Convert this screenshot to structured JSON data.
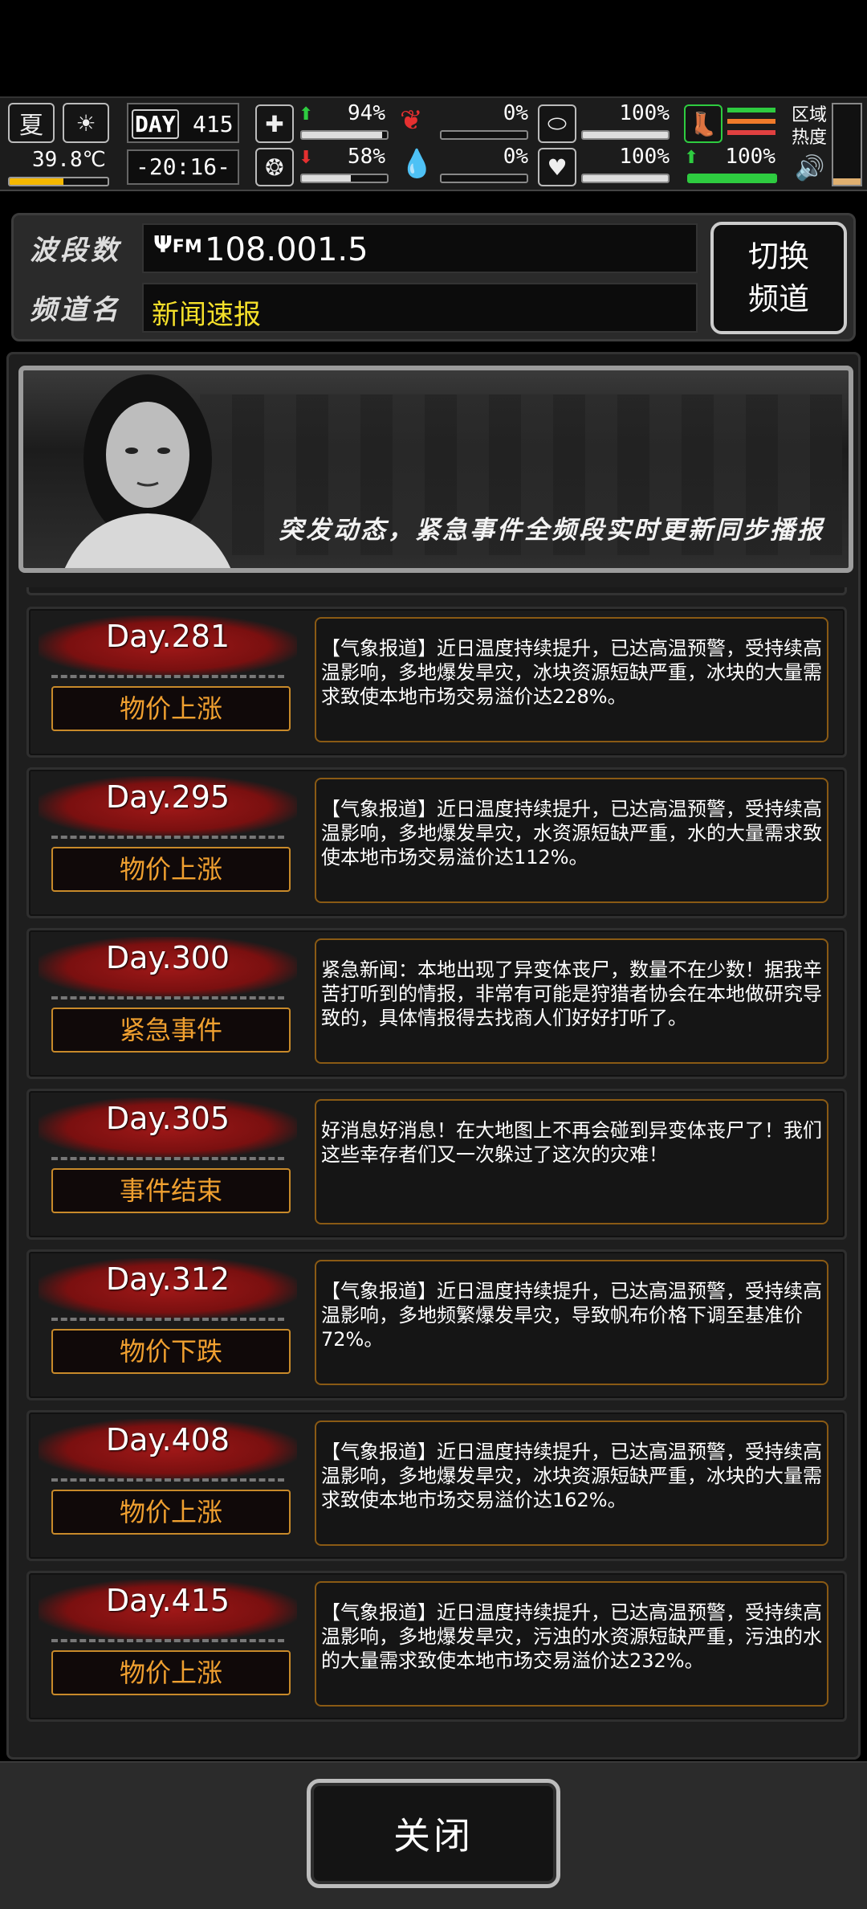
{
  "status": {
    "season": "夏",
    "temperature": "39.8℃",
    "temperature_level": 0.55,
    "day_badge": "DAY",
    "day_number": "415",
    "clock": "-20:16-",
    "stats": [
      {
        "icon": "medkit-icon",
        "arrow": "up",
        "value": "94%",
        "level": 0.94
      },
      {
        "icon": "brain-icon",
        "arrow": "down",
        "value": "58%",
        "level": 0.58
      },
      {
        "icon": "stomach-icon",
        "arrow": "",
        "value": "0%",
        "level": 0
      },
      {
        "icon": "blood-drop-icon",
        "arrow": "",
        "value": "0%",
        "level": 0
      },
      {
        "icon": "pill-icon",
        "arrow": "",
        "value": "100%",
        "level": 1
      },
      {
        "icon": "heart-icon",
        "arrow": "",
        "value": "100%",
        "level": 1
      },
      {
        "icon": "boot-icon",
        "arrow": "up",
        "value": "100%",
        "level": 1
      }
    ],
    "region_label_1": "区域",
    "region_label_2": "热度"
  },
  "radio": {
    "band_label": "波段数",
    "fm_label": "FM",
    "frequency": "108.001.5",
    "channel_label": "频道名",
    "channel_name": "新闻速报",
    "switch_line1": "切换",
    "switch_line2": "频道"
  },
  "banner": {
    "text": "突发动态，紧急事件全频段实时更新同步播报"
  },
  "news": [
    {
      "day": "Day.281",
      "tag": "物价上涨",
      "text": "【气象报道】近日温度持续提升，已达高温预警，受持续高温影响，多地爆发旱灾，冰块资源短缺严重，冰块的大量需求致使本地市场交易溢价达228%。"
    },
    {
      "day": "Day.295",
      "tag": "物价上涨",
      "text": "【气象报道】近日温度持续提升，已达高温预警，受持续高温影响，多地爆发旱灾，水资源短缺严重，水的大量需求致使本地市场交易溢价达112%。"
    },
    {
      "day": "Day.300",
      "tag": "紧急事件",
      "text": "紧急新闻：本地出现了异变体丧尸，数量不在少数！据我辛苦打听到的情报，非常有可能是狩猎者协会在本地做研究导致的，具体情报得去找商人们好好打听了。"
    },
    {
      "day": "Day.305",
      "tag": "事件结束",
      "text": "好消息好消息！在大地图上不再会碰到异变体丧尸了！我们这些幸存者们又一次躲过了这次的灾难！"
    },
    {
      "day": "Day.312",
      "tag": "物价下跌",
      "text": "【气象报道】近日温度持续提升，已达高温预警，受持续高温影响，多地频繁爆发旱灾，导致帆布价格下调至基准价72%。"
    },
    {
      "day": "Day.408",
      "tag": "物价上涨",
      "text": "【气象报道】近日温度持续提升，已达高温预警，受持续高温影响，多地爆发旱灾，冰块资源短缺严重，冰块的大量需求致使本地市场交易溢价达162%。"
    },
    {
      "day": "Day.415",
      "tag": "物价上涨",
      "text": "【气象报道】近日温度持续提升，已达高温预警，受持续高温影响，多地爆发旱灾，污浊的水资源短缺严重，污浊的水的大量需求致使本地市场交易溢价达232%。"
    }
  ],
  "close_label": "关闭"
}
